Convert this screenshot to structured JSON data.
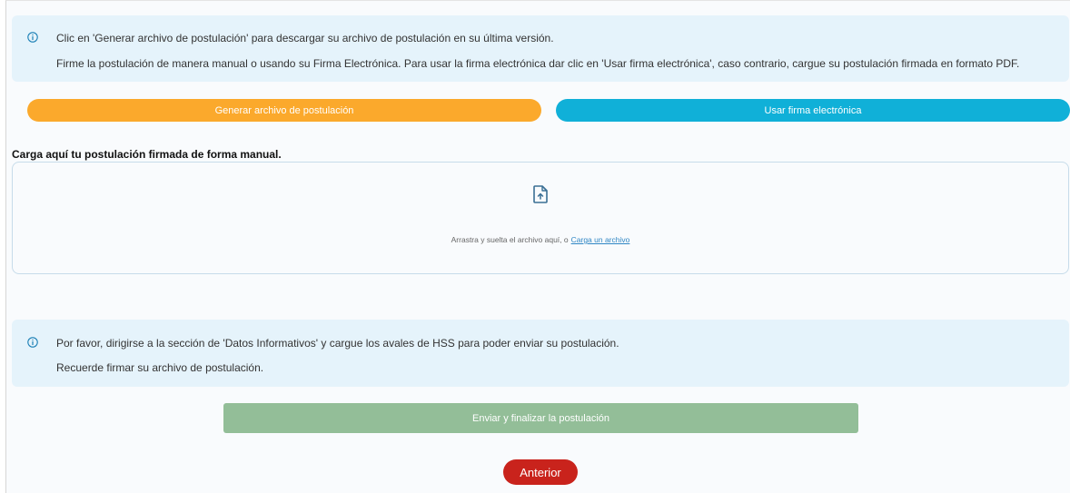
{
  "info_top": {
    "line1": "Clic en 'Generar archivo de postulación' para descargar su archivo de postulación en su última versión.",
    "line2": "Firme la postulación de manera manual o usando su Firma Electrónica. Para usar la firma electrónica dar clic en 'Usar firma electrónica', caso contrario, cargue su postulación firmada en formato PDF."
  },
  "buttons": {
    "generar": "Generar archivo de postulación",
    "firma": "Usar firma electrónica",
    "enviar": "Enviar y finalizar la postulación",
    "anterior": "Anterior"
  },
  "upload": {
    "title": "Carga aquí tu postulación firmada de forma manual.",
    "drop_text": "Arrastra y suelta el archivo aquí, o",
    "link_text": "Carga un archivo"
  },
  "info_bottom": {
    "line1": "Por favor, dirigirse a la sección de 'Datos Informativos' y cargue los avales de HSS para poder enviar su postulación.",
    "line2": "Recuerde firmar su archivo de postulación."
  },
  "icons": {
    "info": "info-icon",
    "upload": "file-upload-icon"
  },
  "colors": {
    "info_bg": "#e5f3fb",
    "generar": "#fba92c",
    "firma": "#10b0d8",
    "enviar": "#93be98",
    "anterior": "#c9231c",
    "link": "#2f86c4"
  }
}
